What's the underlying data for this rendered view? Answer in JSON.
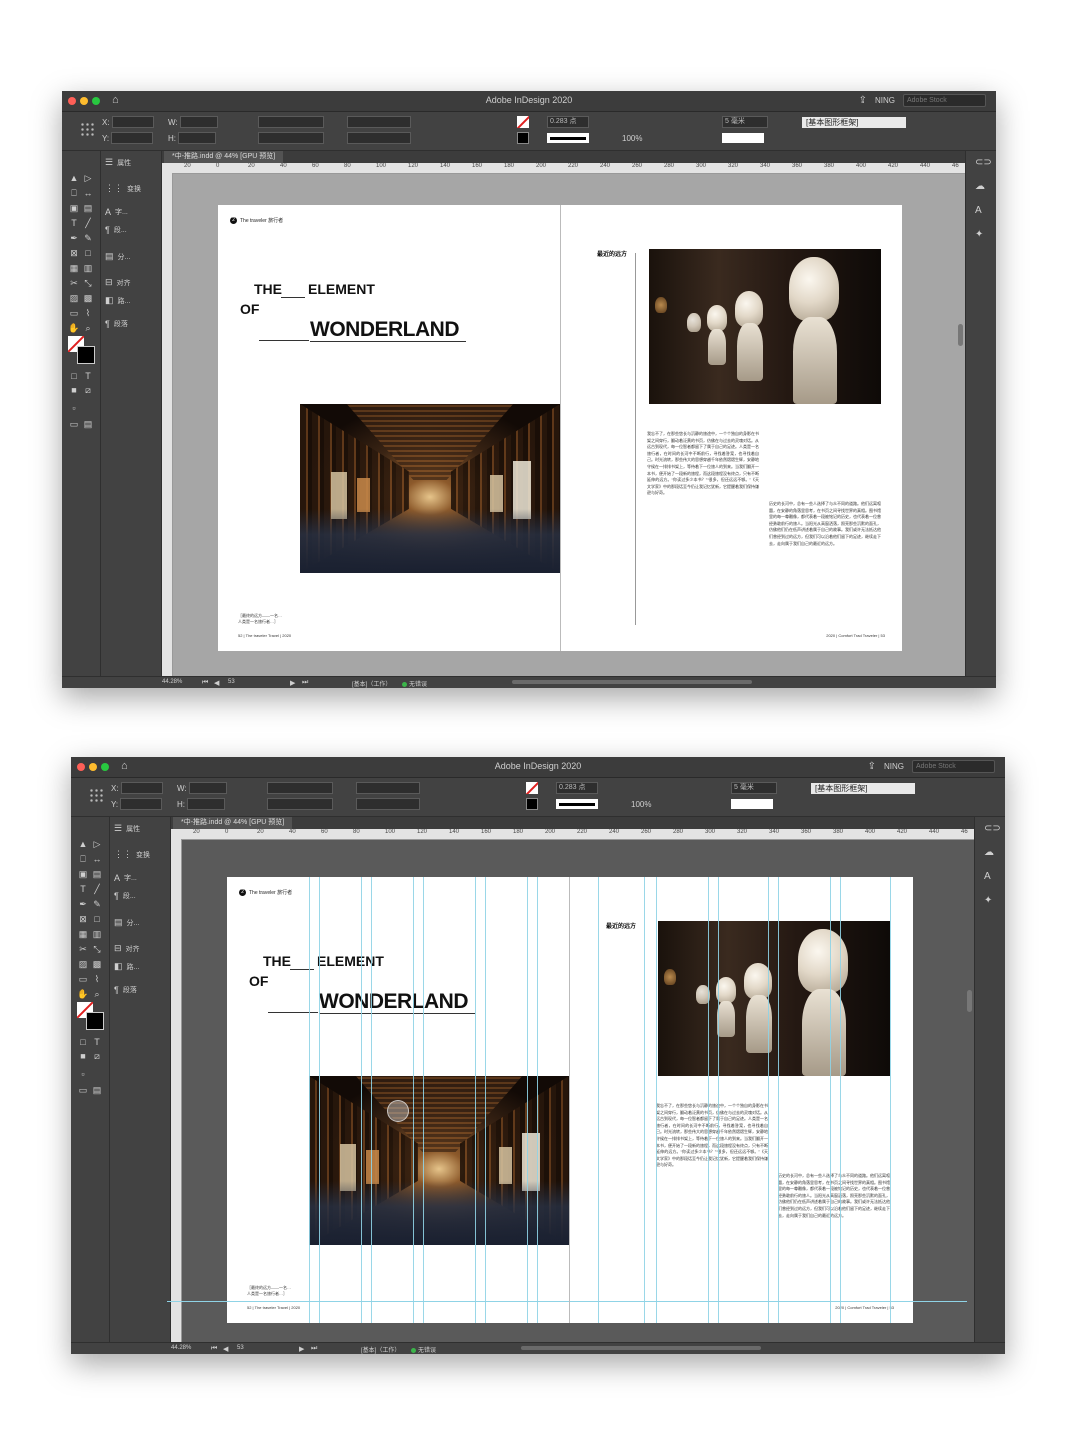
{
  "app_title": "Adobe InDesign 2020",
  "user": "NING",
  "search_placeholder": "Adobe Stock",
  "control": {
    "x_label": "X:",
    "y_label": "Y:",
    "w_label": "W:",
    "h_label": "H:",
    "x_value": "",
    "y_value": "",
    "stroke_weight": "0.283 点",
    "opacity": "100%",
    "spacing": "5 毫米",
    "frame_type": "[基本图形框架]"
  },
  "doc_tab": "*中-推路.indd @ 44% [GPU 预览]",
  "ruler_ticks": [
    "20",
    "0",
    "20",
    "40",
    "60",
    "80",
    "100",
    "120",
    "140",
    "160",
    "180",
    "200",
    "220",
    "240",
    "260",
    "280",
    "300",
    "320",
    "340",
    "360",
    "380",
    "400",
    "420",
    "440",
    "46"
  ],
  "panels": [
    {
      "icon": "properties-icon",
      "label": "属性"
    },
    {
      "icon": "transform-icon",
      "label": "变换"
    },
    {
      "icon": "character-icon",
      "label": "字..."
    },
    {
      "icon": "paragraph-icon",
      "label": "段..."
    },
    {
      "icon": "pages-icon",
      "label": "分..."
    },
    {
      "icon": "align-icon",
      "label": "对齐"
    },
    {
      "icon": "pathfinder-icon",
      "label": "路..."
    },
    {
      "icon": "paragraph-style-icon",
      "label": "段落"
    }
  ],
  "status": {
    "zoom": "44.28%",
    "page": "53",
    "master": "[基本]（工作）",
    "preflight": "无错误"
  },
  "spread": {
    "header_num": "2",
    "header_tag": "The traveler 旅行者",
    "title_the": "THE",
    "title_element": "ELEMENT",
    "title_of": "OF",
    "title_wonderland": "WONDERLAND",
    "caption_line1": "［最终的远方——一名…",
    "caption_line2": "人类是一名旅行者…］",
    "footer_left": "52 | The traveler Travel | 2020",
    "footer_right": "2020 | Comfort Trad Traveler | 53",
    "recent_title": "最近的远方",
    "body_col1": "我忘不了，在那些悠长与沉静的旅途中，一个个独自的身影在书架之间穿行，翻动着泛黄的书页，仿佛在与过去的灵魂对话。从远古到现代，每一位智者都留下了属于自己的足迹。人类是一名旅行者，在时间的长河中不断前行，寻找着答案，也寻找着自己。时光流转，那些伟大的思想穿越千年依然熠熠生辉，安静地守候在一排排书架上，等待着下一位旅人的到来。当我们翻开一本书，便开始了一段新的旅程，而这段旅程没有终点，只有不断延伸的远方。“你读过多少本书？”“很多，但还远远不够。”《天文学家》中的那段话至今仍让我记忆犹新，它提醒着我们保持谦逊与好奇。",
    "body_col2": "历史的长河中，总有一些人选择了与众不同的道路。他们远离喧嚣，在安静的角落里思考，在书页之间寻找世界的真相。图书馆里的每一尊雕像，都代表着一段被铭记的历史，也代表着一位曾经勇敢前行的旅人。当阳光从高窗洒落，照亮那些沉默的面孔，仿佛他们仍在低声讲述着属于自己的故事。我们或许无法抵达他们曾经到过的远方，但我们可以沿着他们留下的足迹，继续走下去，走向属于我们自己的最近的远方。"
  }
}
